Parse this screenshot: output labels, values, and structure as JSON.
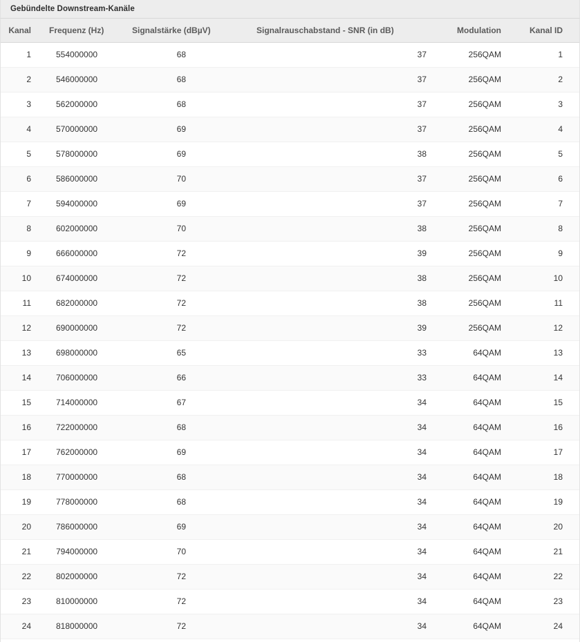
{
  "panel": {
    "title": "Gebündelte Downstream-Kanäle"
  },
  "table": {
    "columns": [
      {
        "key": "kanal",
        "label": "Kanal"
      },
      {
        "key": "frequenz",
        "label": "Frequenz (Hz)"
      },
      {
        "key": "signal",
        "label": "Signalstärke (dBµV)"
      },
      {
        "key": "snr",
        "label": "Signalrauschabstand - SNR (in dB)"
      },
      {
        "key": "modulation",
        "label": "Modulation"
      },
      {
        "key": "kanal_id",
        "label": "Kanal ID"
      }
    ],
    "rows": [
      {
        "kanal": "1",
        "frequenz": "554000000",
        "signal": "68",
        "snr": "37",
        "modulation": "256QAM",
        "kanal_id": "1"
      },
      {
        "kanal": "2",
        "frequenz": "546000000",
        "signal": "68",
        "snr": "37",
        "modulation": "256QAM",
        "kanal_id": "2"
      },
      {
        "kanal": "3",
        "frequenz": "562000000",
        "signal": "68",
        "snr": "37",
        "modulation": "256QAM",
        "kanal_id": "3"
      },
      {
        "kanal": "4",
        "frequenz": "570000000",
        "signal": "69",
        "snr": "37",
        "modulation": "256QAM",
        "kanal_id": "4"
      },
      {
        "kanal": "5",
        "frequenz": "578000000",
        "signal": "69",
        "snr": "38",
        "modulation": "256QAM",
        "kanal_id": "5"
      },
      {
        "kanal": "6",
        "frequenz": "586000000",
        "signal": "70",
        "snr": "37",
        "modulation": "256QAM",
        "kanal_id": "6"
      },
      {
        "kanal": "7",
        "frequenz": "594000000",
        "signal": "69",
        "snr": "37",
        "modulation": "256QAM",
        "kanal_id": "7"
      },
      {
        "kanal": "8",
        "frequenz": "602000000",
        "signal": "70",
        "snr": "38",
        "modulation": "256QAM",
        "kanal_id": "8"
      },
      {
        "kanal": "9",
        "frequenz": "666000000",
        "signal": "72",
        "snr": "39",
        "modulation": "256QAM",
        "kanal_id": "9"
      },
      {
        "kanal": "10",
        "frequenz": "674000000",
        "signal": "72",
        "snr": "38",
        "modulation": "256QAM",
        "kanal_id": "10"
      },
      {
        "kanal": "11",
        "frequenz": "682000000",
        "signal": "72",
        "snr": "38",
        "modulation": "256QAM",
        "kanal_id": "11"
      },
      {
        "kanal": "12",
        "frequenz": "690000000",
        "signal": "72",
        "snr": "39",
        "modulation": "256QAM",
        "kanal_id": "12"
      },
      {
        "kanal": "13",
        "frequenz": "698000000",
        "signal": "65",
        "snr": "33",
        "modulation": "64QAM",
        "kanal_id": "13"
      },
      {
        "kanal": "14",
        "frequenz": "706000000",
        "signal": "66",
        "snr": "33",
        "modulation": "64QAM",
        "kanal_id": "14"
      },
      {
        "kanal": "15",
        "frequenz": "714000000",
        "signal": "67",
        "snr": "34",
        "modulation": "64QAM",
        "kanal_id": "15"
      },
      {
        "kanal": "16",
        "frequenz": "722000000",
        "signal": "68",
        "snr": "34",
        "modulation": "64QAM",
        "kanal_id": "16"
      },
      {
        "kanal": "17",
        "frequenz": "762000000",
        "signal": "69",
        "snr": "34",
        "modulation": "64QAM",
        "kanal_id": "17"
      },
      {
        "kanal": "18",
        "frequenz": "770000000",
        "signal": "68",
        "snr": "34",
        "modulation": "64QAM",
        "kanal_id": "18"
      },
      {
        "kanal": "19",
        "frequenz": "778000000",
        "signal": "68",
        "snr": "34",
        "modulation": "64QAM",
        "kanal_id": "19"
      },
      {
        "kanal": "20",
        "frequenz": "786000000",
        "signal": "69",
        "snr": "34",
        "modulation": "64QAM",
        "kanal_id": "20"
      },
      {
        "kanal": "21",
        "frequenz": "794000000",
        "signal": "70",
        "snr": "34",
        "modulation": "64QAM",
        "kanal_id": "21"
      },
      {
        "kanal": "22",
        "frequenz": "802000000",
        "signal": "72",
        "snr": "34",
        "modulation": "64QAM",
        "kanal_id": "22"
      },
      {
        "kanal": "23",
        "frequenz": "810000000",
        "signal": "72",
        "snr": "34",
        "modulation": "64QAM",
        "kanal_id": "23"
      },
      {
        "kanal": "24",
        "frequenz": "818000000",
        "signal": "72",
        "snr": "34",
        "modulation": "64QAM",
        "kanal_id": "24"
      }
    ]
  },
  "colors": {
    "header_bg": "#ededed",
    "header_text": "#5b5b5b",
    "title_text": "#2f2f2f",
    "body_text": "#333333",
    "row_odd": "#ffffff",
    "row_even": "#fafafa",
    "border": "#d8d8d8"
  }
}
